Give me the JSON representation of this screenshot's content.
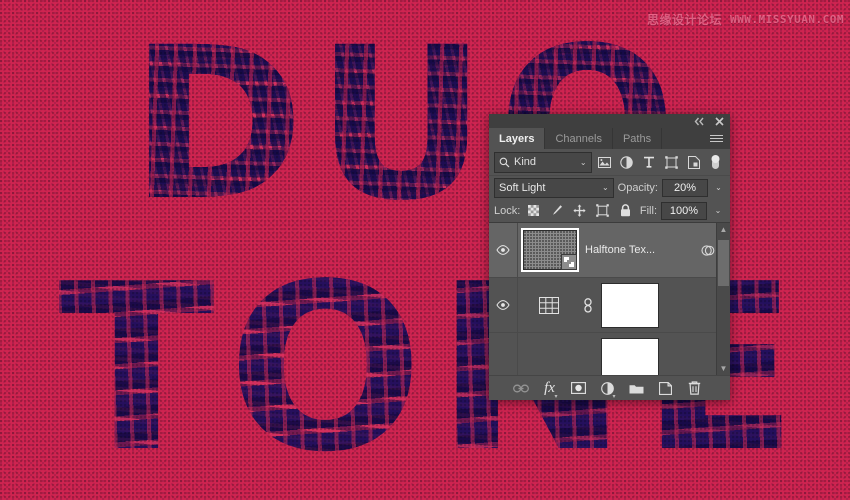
{
  "artwork": {
    "word_top": "DUO",
    "word_bottom": "TONE",
    "background_color": "#cf2450",
    "duotone_dark": "#2e1a68",
    "duotone_light": "#e23a5c"
  },
  "watermark": {
    "site_name": "思缘设计论坛",
    "url": "WWW.MISSYUAN.COM"
  },
  "panel": {
    "titlebar": {
      "collapse_icon": "double-chevron-left-icon",
      "close_icon": "close-icon"
    },
    "tabs": [
      {
        "label": "Layers",
        "active": true
      },
      {
        "label": "Channels",
        "active": false
      },
      {
        "label": "Paths",
        "active": false
      }
    ],
    "menu_icon": "hamburger-menu-icon",
    "filter": {
      "kind_label": "Kind",
      "search_icon": "search-icon",
      "caret": "⌄",
      "type_filters": [
        {
          "name": "filter-pixel-layers",
          "icon": "image-icon"
        },
        {
          "name": "filter-adjustment-layers",
          "icon": "adjustment-circle-icon"
        },
        {
          "name": "filter-type-layers",
          "icon": "text-t-icon"
        },
        {
          "name": "filter-shape-layers",
          "icon": "shape-bounding-box-icon"
        },
        {
          "name": "filter-smart-objects",
          "icon": "smart-object-icon"
        }
      ],
      "toggle_name": "filter-enable-toggle"
    },
    "blend": {
      "mode": "Soft Light",
      "opacity_label": "Opacity:",
      "opacity_value": "20%"
    },
    "lock": {
      "label": "Lock:",
      "items": [
        {
          "name": "lock-transparent-pixels",
          "icon": "checkerboard-icon"
        },
        {
          "name": "lock-image-pixels",
          "icon": "brush-icon"
        },
        {
          "name": "lock-position",
          "icon": "move-arrows-icon"
        },
        {
          "name": "lock-artboard-nesting",
          "icon": "artboard-icon"
        },
        {
          "name": "lock-all",
          "icon": "padlock-icon"
        }
      ],
      "fill_label": "Fill:",
      "fill_value": "100%"
    },
    "layers": [
      {
        "name": "Halftone Tex...",
        "visible": true,
        "selected": true,
        "thumb_type": "halftone-pattern",
        "smart_object": true,
        "has_effects": true,
        "expand_caret": "⌄"
      },
      {
        "name": "",
        "visible": true,
        "selected": false,
        "thumb_type": "grid-pattern",
        "linked": true,
        "has_mask": true
      },
      {
        "name": "",
        "visible": false,
        "selected": false,
        "thumb_type": "mask-only",
        "has_mask": true
      }
    ],
    "scrollbar": {
      "up_arrow": "chevron-up-icon",
      "down_arrow": "chevron-down-icon"
    },
    "footer_buttons": [
      {
        "name": "link-layers-button",
        "icon": "link-icon",
        "enabled": false
      },
      {
        "name": "layer-style-button",
        "icon": "fx-icon",
        "enabled": true
      },
      {
        "name": "add-layer-mask-button",
        "icon": "mask-icon",
        "enabled": true
      },
      {
        "name": "new-adjustment-layer-button",
        "icon": "half-circle-icon",
        "enabled": true
      },
      {
        "name": "new-group-button",
        "icon": "folder-icon",
        "enabled": true
      },
      {
        "name": "new-layer-button",
        "icon": "new-layer-icon",
        "enabled": true
      },
      {
        "name": "delete-layer-button",
        "icon": "trash-icon",
        "enabled": true
      }
    ]
  }
}
